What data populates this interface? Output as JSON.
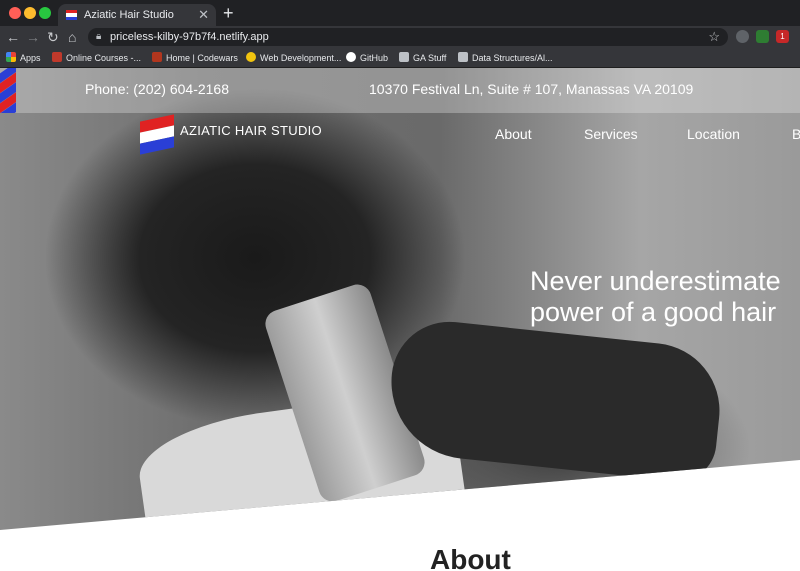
{
  "browser": {
    "tab_title": "Aziatic Hair Studio",
    "url": "priceless-kilby-97b7f4.netlify.app",
    "tab_close": "✕",
    "new_tab": "+",
    "bookmarks": [
      {
        "label": "Apps",
        "icon": "apps-grid-icon"
      },
      {
        "label": "Online Courses -...",
        "icon": "courses-icon"
      },
      {
        "label": "Home | Codewars",
        "icon": "codewars-icon"
      },
      {
        "label": "Web Development...",
        "icon": "web-dev-icon"
      },
      {
        "label": "GitHub",
        "icon": "github-icon"
      },
      {
        "label": "GA Stuff",
        "icon": "folder-icon"
      },
      {
        "label": "Data Structures/Al...",
        "icon": "folder-icon"
      }
    ],
    "extension_badge": "1"
  },
  "site": {
    "phone": "Phone: (202) 604-2168",
    "address": "10370 Festival Ln, Suite # 107, Manassas VA 20109",
    "logo_text": "AZIATIC HAIR STUDIO",
    "nav": [
      "About",
      "Services",
      "Location",
      "B"
    ],
    "tagline_line1": "Never underestimate",
    "tagline_line2": "power of a good hair",
    "about_heading": "About"
  },
  "colors": {
    "flag_red": "#e02222",
    "flag_white": "#ffffff",
    "flag_blue": "#2a3fd6"
  }
}
